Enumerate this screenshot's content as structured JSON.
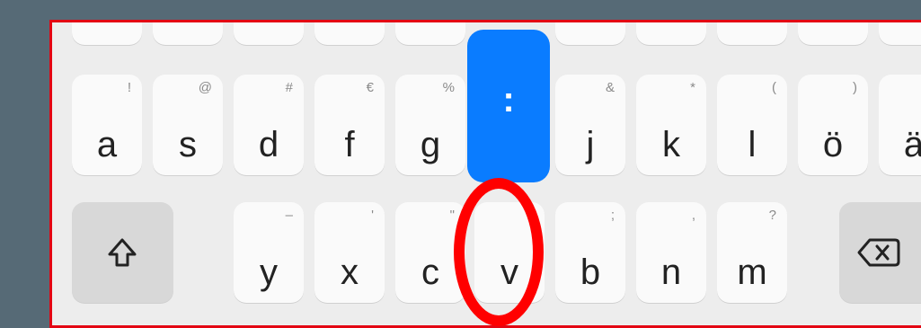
{
  "keyboard": {
    "row_home": [
      {
        "main": "a",
        "sec": "!"
      },
      {
        "main": "s",
        "sec": "@"
      },
      {
        "main": "d",
        "sec": "#"
      },
      {
        "main": "f",
        "sec": "€"
      },
      {
        "main": "g",
        "sec": "%"
      },
      {
        "main": "j",
        "sec": "&"
      },
      {
        "main": "k",
        "sec": "*"
      },
      {
        "main": "l",
        "sec": "("
      },
      {
        "main": "ö",
        "sec": ")"
      },
      {
        "main": "ä",
        "sec": ""
      }
    ],
    "row_bottom": [
      {
        "main": "y",
        "sec": "–"
      },
      {
        "main": "x",
        "sec": "'"
      },
      {
        "main": "c",
        "sec": "\""
      },
      {
        "main": "v",
        "sec": ":"
      },
      {
        "main": "b",
        "sec": ";"
      },
      {
        "main": "n",
        "sec": ","
      },
      {
        "main": "m",
        "sec": "?"
      }
    ],
    "popup_symbol": ":",
    "icons": {
      "shift": "shift-icon",
      "backspace": "backspace-icon"
    },
    "colors": {
      "popup": "#0a7cff",
      "highlight": "#ff0000",
      "frame": "#e30613"
    }
  }
}
